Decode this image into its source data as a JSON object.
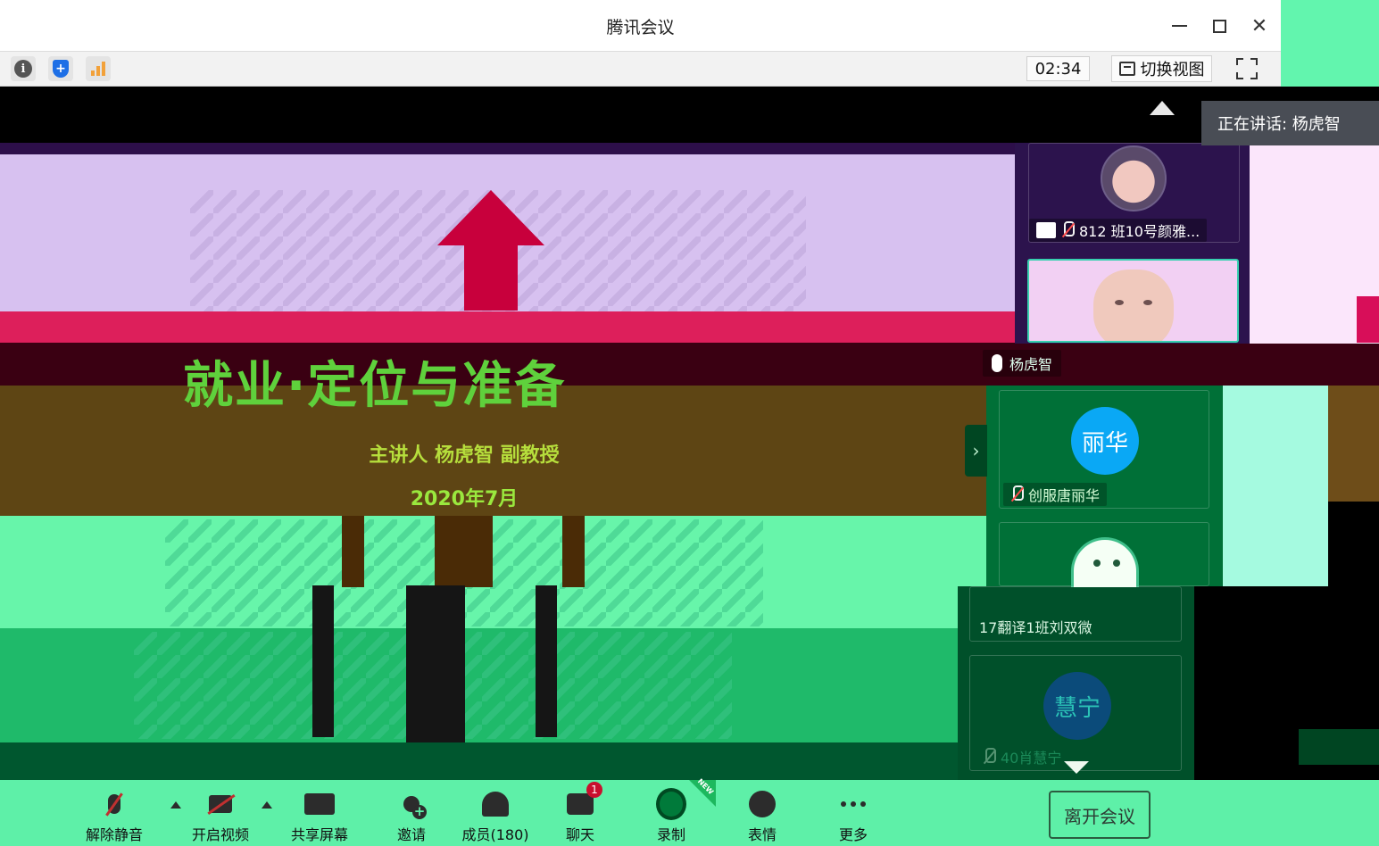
{
  "window": {
    "title": "腾讯会议"
  },
  "infobar": {
    "timer": "02:34",
    "switch_view_label": "切换视图"
  },
  "slide": {
    "title": "就业·定位与准备",
    "presenter": "主讲人 杨虎智  副教授",
    "date": "2020年7月"
  },
  "speaking": {
    "text": "正在讲话: 杨虎智"
  },
  "participants": [
    {
      "name": "812 班10号颜雅...",
      "muted": true,
      "sharing": true
    },
    {
      "name": "杨虎智",
      "muted": false
    },
    {
      "name": "创服唐丽华",
      "avatar_text": "丽华",
      "muted": true
    },
    {
      "name": "17翻译1班刘双微",
      "muted": false
    },
    {
      "name": "40肖慧宁",
      "avatar_text": "慧宁",
      "muted": true
    }
  ],
  "toolbar": {
    "unmute_label": "解除静音",
    "video_label": "开启视频",
    "share_label": "共享屏幕",
    "invite_label": "邀请",
    "members_label": "成员(180)",
    "chat_label": "聊天",
    "chat_badge": "1",
    "record_label": "录制",
    "record_tag": "NEW",
    "emoji_label": "表情",
    "more_label": "更多",
    "leave_label": "离开会议"
  },
  "colors": {
    "avatar_lihua": "#0aa8f5",
    "avatar_huining": "#0b4b7a",
    "chat_badge": "#c8102e",
    "slide_arrow": "#c8003c"
  }
}
